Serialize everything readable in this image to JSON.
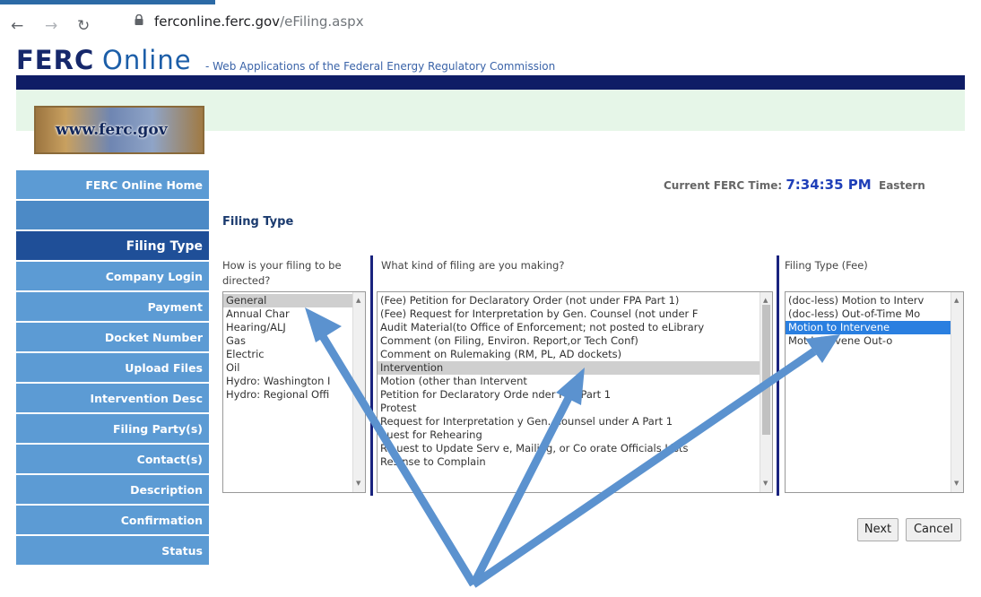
{
  "browser": {
    "url_domain": "ferconline.ferc.gov",
    "url_path": "/eFiling.aspx"
  },
  "header": {
    "logo_part1": "FERC",
    "logo_part2": "Online",
    "subtitle": "- Web Applications of the Federal Energy Regulatory Commission",
    "site_image_text": "www.ferc.gov"
  },
  "sidebar": {
    "items": [
      {
        "label": "FERC Online Home"
      },
      {
        "label": ""
      },
      {
        "label": "Filing Type"
      },
      {
        "label": "Company Login"
      },
      {
        "label": "Payment"
      },
      {
        "label": "Docket Number"
      },
      {
        "label": "Upload Files"
      },
      {
        "label": "Intervention Desc"
      },
      {
        "label": "Filing Party(s)"
      },
      {
        "label": "Contact(s)"
      },
      {
        "label": "Description"
      },
      {
        "label": "Confirmation"
      },
      {
        "label": "Status"
      }
    ]
  },
  "main": {
    "current_time_label": "Current FERC Time:",
    "current_time_value": "7:34:35 PM",
    "current_time_zone": "Eastern",
    "section_title": "Filing Type",
    "col1_header": "How is your filing to be directed?",
    "col2_header": "What kind of filing are you making?",
    "col3_header": "Filing Type (Fee)",
    "directed_options": [
      "General",
      "Annual Char",
      "Hearing/ALJ",
      "Gas",
      "Electric",
      "Oil",
      "Hydro: Washington I",
      "Hydro: Regional Offi"
    ],
    "kind_options": [
      "(Fee) Petition for Declaratory Order (not under FPA Part 1)",
      "(Fee) Request for Interpretation by Gen. Counsel (not under F",
      "Audit Material(to Office of Enforcement; not posted to eLibrary",
      "Comment (on Filing, Environ. Report,or Tech Conf)",
      "Comment on Rulemaking (RM, PL, AD dockets)",
      "Intervention",
      "Motion (other than Intervent",
      "Petition for Declaratory Orde     nder FPA Part 1",
      "Protest",
      "Request for Interpretation   y Gen. Counsel under   A Part 1",
      "    quest for Rehearing",
      "Re    uest to Update Serv    e, Mailing, or Co    orate Officials Lists",
      "Res    nse to Complain"
    ],
    "fee_options": [
      "(doc-less) Motion to Interv",
      "(doc-less) Out-of-Time Mo",
      "Motion to Intervene",
      "Mot       Intervene Out-o"
    ],
    "next_label": "Next",
    "cancel_label": "Cancel"
  },
  "colors": {
    "navy_bar": "#0f1d66",
    "sidebar_bg": "#5c9bd4",
    "sidebar_active": "#1f4f98",
    "arrow": "#5b92cf",
    "selection_blue": "#2a7fe0"
  }
}
